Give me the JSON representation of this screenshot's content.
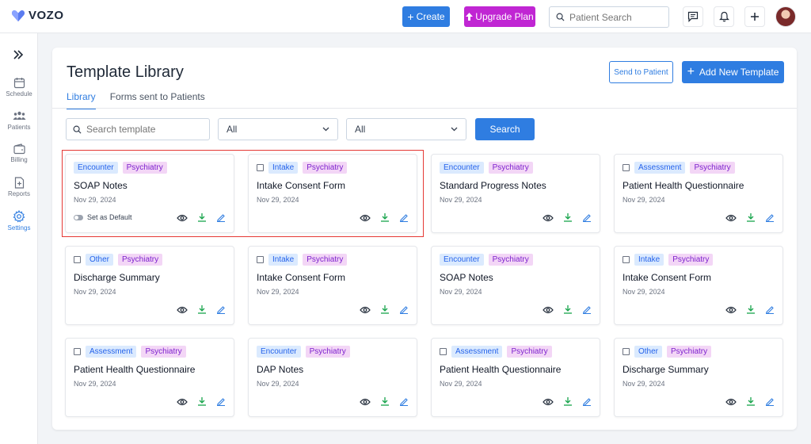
{
  "app": {
    "name": "VOZO"
  },
  "topbar": {
    "create_label": "Create",
    "upgrade_label": "Upgrade Plan",
    "search_placeholder": "Patient Search"
  },
  "sidebar": {
    "items": [
      {
        "label": "Schedule",
        "icon": "calendar-icon"
      },
      {
        "label": "Patients",
        "icon": "users-icon"
      },
      {
        "label": "Billing",
        "icon": "wallet-icon"
      },
      {
        "label": "Reports",
        "icon": "report-icon"
      },
      {
        "label": "Settings",
        "icon": "gear-icon",
        "active": true
      }
    ]
  },
  "page": {
    "title": "Template Library",
    "send_label": "Send to Patient",
    "add_label": "Add New Template",
    "tabs": [
      {
        "label": "Library",
        "active": true
      },
      {
        "label": "Forms sent to Patients"
      }
    ]
  },
  "filters": {
    "search_placeholder": "Search template",
    "select1": "All",
    "select2": "All",
    "search_button": "Search"
  },
  "colors": {
    "accent": "#2f7de1",
    "upgrade": "#c026d3",
    "highlight": "#e53935"
  },
  "templates": [
    {
      "category": "Encounter",
      "specialty": "Psychiatry",
      "name": "SOAP Notes",
      "date": "Nov 29, 2024",
      "checkbox": false,
      "default_label": "Set as Default"
    },
    {
      "category": "Intake",
      "specialty": "Psychiatry",
      "name": "Intake Consent Form",
      "date": "Nov 29, 2024",
      "checkbox": true
    },
    {
      "category": "Encounter",
      "specialty": "Psychiatry",
      "name": "Standard Progress Notes",
      "date": "Nov 29, 2024",
      "checkbox": false
    },
    {
      "category": "Assessment",
      "specialty": "Psychiatry",
      "name": "Patient Health Questionnaire",
      "date": "Nov 29, 2024",
      "checkbox": true
    },
    {
      "category": "Other",
      "specialty": "Psychiatry",
      "name": "Discharge Summary",
      "date": "Nov 29, 2024",
      "checkbox": true
    },
    {
      "category": "Intake",
      "specialty": "Psychiatry",
      "name": "Intake Consent Form",
      "date": "Nov 29, 2024",
      "checkbox": true
    },
    {
      "category": "Encounter",
      "specialty": "Psychiatry",
      "name": "SOAP Notes",
      "date": "Nov 29, 2024",
      "checkbox": false
    },
    {
      "category": "Intake",
      "specialty": "Psychiatry",
      "name": "Intake Consent Form",
      "date": "Nov 29, 2024",
      "checkbox": true
    },
    {
      "category": "Assessment",
      "specialty": "Psychiatry",
      "name": "Patient Health Questionnaire",
      "date": "Nov 29, 2024",
      "checkbox": true
    },
    {
      "category": "Encounter",
      "specialty": "Psychiatry",
      "name": "DAP Notes",
      "date": "Nov 29, 2024",
      "checkbox": false
    },
    {
      "category": "Assessment",
      "specialty": "Psychiatry",
      "name": "Patient Health Questionnaire",
      "date": "Nov 29, 2024",
      "checkbox": true
    },
    {
      "category": "Other",
      "specialty": "Psychiatry",
      "name": "Discharge Summary",
      "date": "Nov 29, 2024",
      "checkbox": true
    }
  ]
}
